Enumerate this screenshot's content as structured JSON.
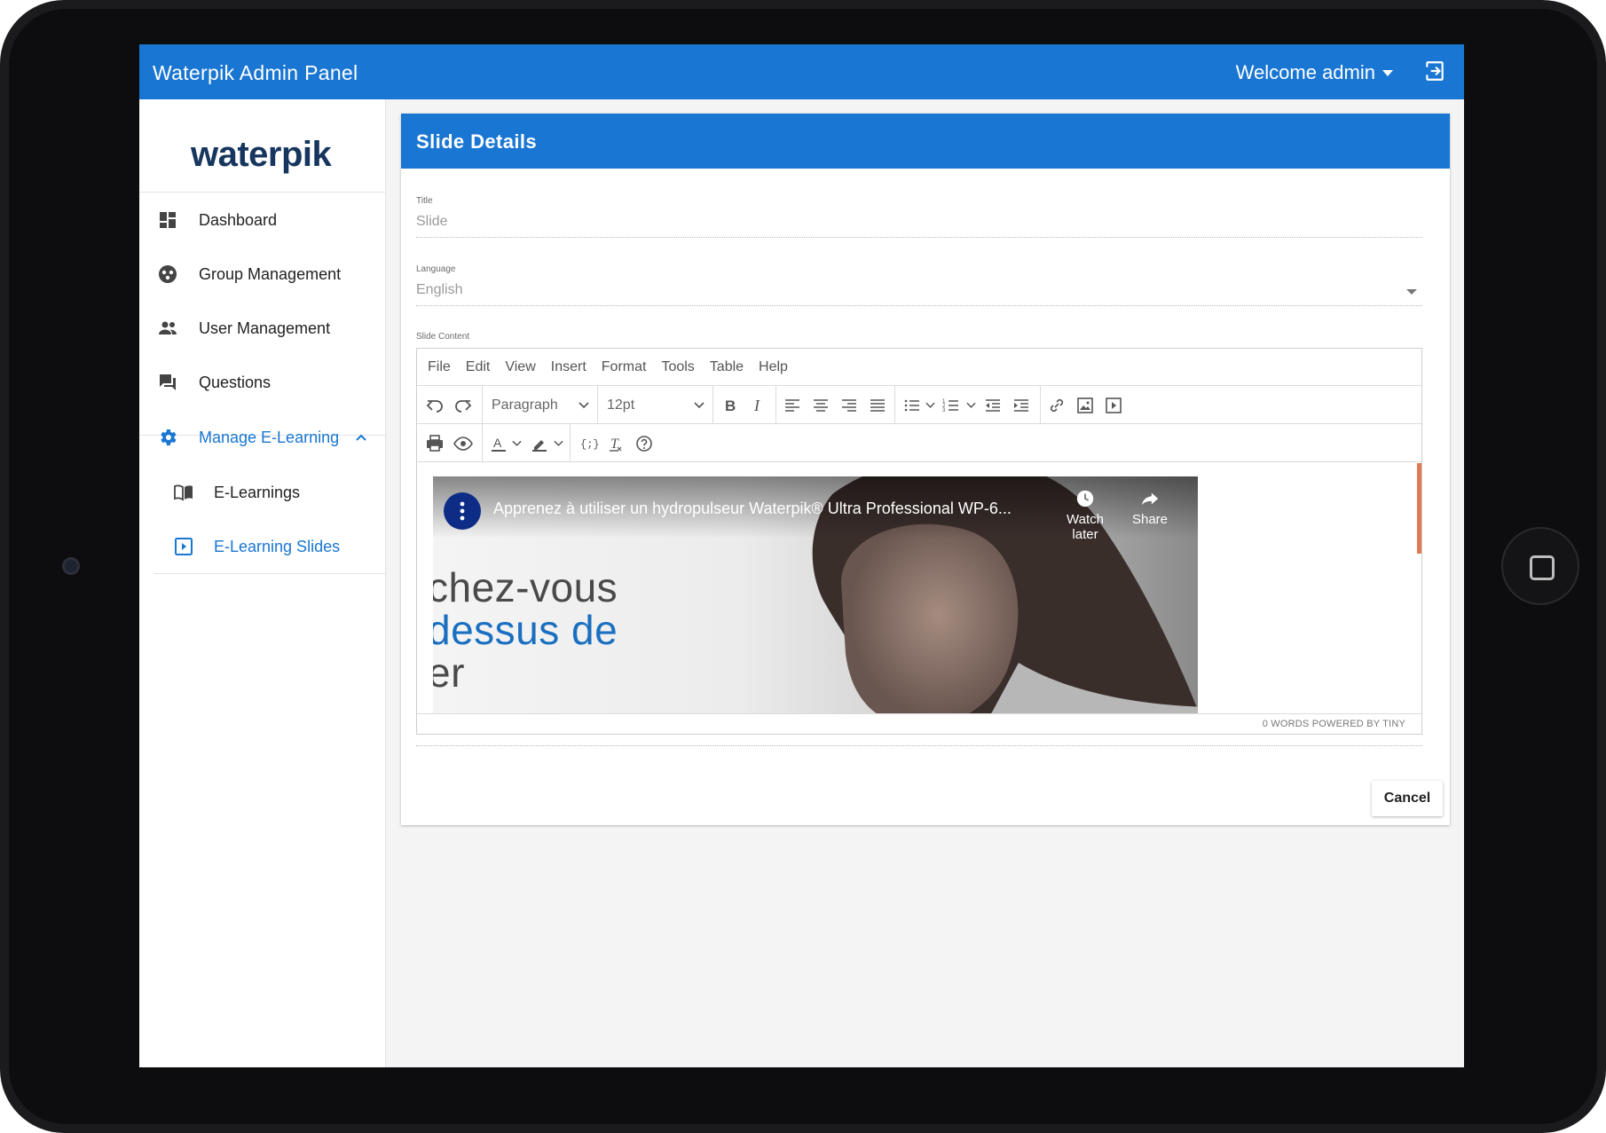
{
  "app": {
    "title": "Waterpik Admin Panel",
    "welcome": "Welcome admin",
    "brand_color": "#1976d2"
  },
  "sidebar": {
    "logo_text": "waterpik",
    "items": [
      {
        "label": "Dashboard",
        "icon": "dashboard-icon"
      },
      {
        "label": "Group Management",
        "icon": "group-icon"
      },
      {
        "label": "User Management",
        "icon": "users-icon"
      },
      {
        "label": "Questions",
        "icon": "questions-icon"
      },
      {
        "label": "Manage E-Learning",
        "icon": "gear-icon",
        "expanded": true
      },
      {
        "label": "E-Learnings",
        "icon": "book-icon"
      },
      {
        "label": "E-Learning Slides",
        "icon": "slides-icon",
        "active": true
      }
    ]
  },
  "card": {
    "title": "Slide Details",
    "title_field": {
      "label": "Title",
      "value": "Slide"
    },
    "language_field": {
      "label": "Language",
      "value": "English"
    },
    "content_label": "Slide Content",
    "cancel_label": "Cancel"
  },
  "editor": {
    "menu": [
      "File",
      "Edit",
      "View",
      "Insert",
      "Format",
      "Tools",
      "Table",
      "Help"
    ],
    "block_format": "Paragraph",
    "font_size": "12pt",
    "status": "0 WORDS  POWERED BY TINY",
    "video": {
      "title": "Apprenez à utiliser un hydropulseur Waterpik® Ultra Professional WP-6...",
      "watch_later": "Watch later",
      "share": "Share",
      "overlay": [
        "chez-vous",
        "dessus de",
        "er"
      ]
    },
    "accent_color": "#e07a52"
  }
}
